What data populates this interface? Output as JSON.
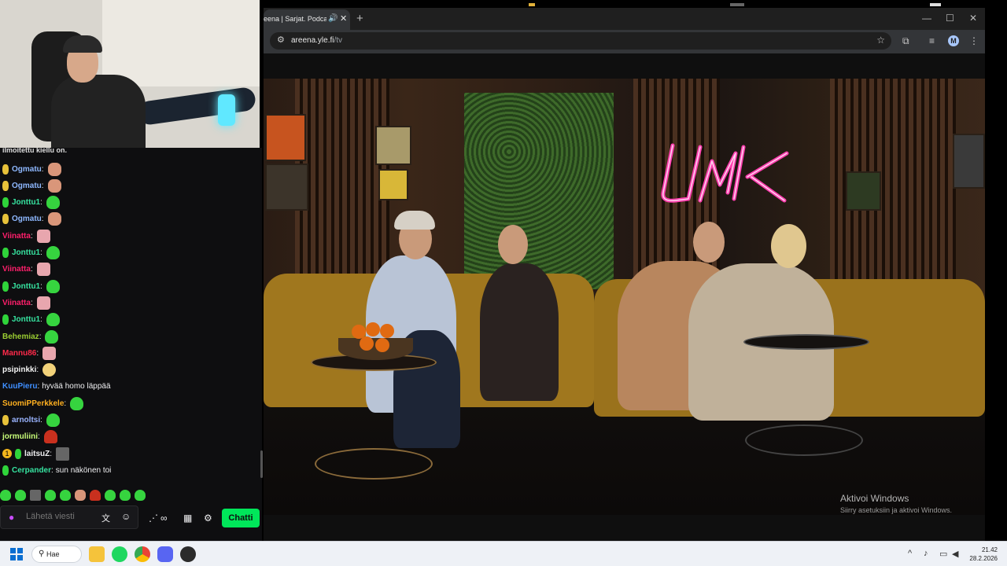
{
  "browser": {
    "tab_title": "eena | Sarjat. Podcast",
    "url_domain": "areena.yle.fi",
    "url_path": "/tv"
  },
  "video": {
    "neon_sign": "UMK",
    "watermark_title": "Aktivoi Windows",
    "watermark_subtitle": "Siirry asetuksiin ja aktivoi Windows."
  },
  "chat": {
    "truncated_top": "ilmoitettu kiellu on.",
    "messages": [
      {
        "badge": "peanut",
        "user": "Ogmatu",
        "color": "#8eb8ff",
        "text": "",
        "emote": "face"
      },
      {
        "badge": "peanut",
        "user": "Ogmatu",
        "color": "#8eb8ff",
        "text": "",
        "emote": "face"
      },
      {
        "badge": "frog",
        "user": "Jonttu1",
        "color": "#36e3a0",
        "text": "",
        "emote": "frog"
      },
      {
        "badge": "peanut",
        "user": "Ogmatu",
        "color": "#8eb8ff",
        "text": "",
        "emote": "face"
      },
      {
        "badge": "",
        "user": "Viinatta",
        "color": "#ff1f6b",
        "text": "",
        "emote": "pink"
      },
      {
        "badge": "frog",
        "user": "Jonttu1",
        "color": "#36e3a0",
        "text": "",
        "emote": "frog"
      },
      {
        "badge": "",
        "user": "Viinatta",
        "color": "#ff1f6b",
        "text": "",
        "emote": "pink"
      },
      {
        "badge": "frog",
        "user": "Jonttu1",
        "color": "#36e3a0",
        "text": "",
        "emote": "frog"
      },
      {
        "badge": "",
        "user": "Viinatta",
        "color": "#ff1f6b",
        "text": "",
        "emote": "pink"
      },
      {
        "badge": "frog",
        "user": "Jonttu1",
        "color": "#36e3a0",
        "text": "",
        "emote": "frog"
      },
      {
        "badge": "",
        "user": "Behemiaz",
        "color": "#9acd32",
        "text": "",
        "emote": "frog"
      },
      {
        "badge": "",
        "user": "Mannu86",
        "color": "#ff2a4a",
        "text": "",
        "emote": "pink"
      },
      {
        "badge": "",
        "user": "psipinkki",
        "color": "#f3f3f3",
        "text": "",
        "emote": "peep"
      },
      {
        "badge": "",
        "user": "KuuPieru",
        "color": "#3f8fff",
        "text": "hyvää homo läppää",
        "emote": ""
      },
      {
        "badge": "",
        "user": "SuomiPPerkkele",
        "color": "#ffb020",
        "text": "",
        "emote": "frog"
      },
      {
        "badge": "peanut",
        "user": "arnoltsi",
        "color": "#9ab4ff",
        "text": "",
        "emote": "frog"
      },
      {
        "badge": "",
        "user": "jormuliini",
        "color": "#c9ff7a",
        "text": "",
        "emote": "mush"
      },
      {
        "badge": "one-frog",
        "user": "laitsuZ",
        "color": "#efeff1",
        "text": "",
        "emote": "gray"
      },
      {
        "badge": "frog",
        "user": "Cerpander",
        "color": "#36e3a0",
        "text": "sun näkönen toi",
        "emote": ""
      }
    ],
    "input_placeholder": "Lähetä viesti",
    "send_label": "Chatti"
  },
  "taskbar": {
    "search_label": "Hae",
    "time": "21.42",
    "date": "28.2.2026"
  },
  "colors": {
    "accent_green": "#00e65a",
    "twitch_purple": "#c94cff",
    "neon_pink": "#ff3fb0"
  }
}
